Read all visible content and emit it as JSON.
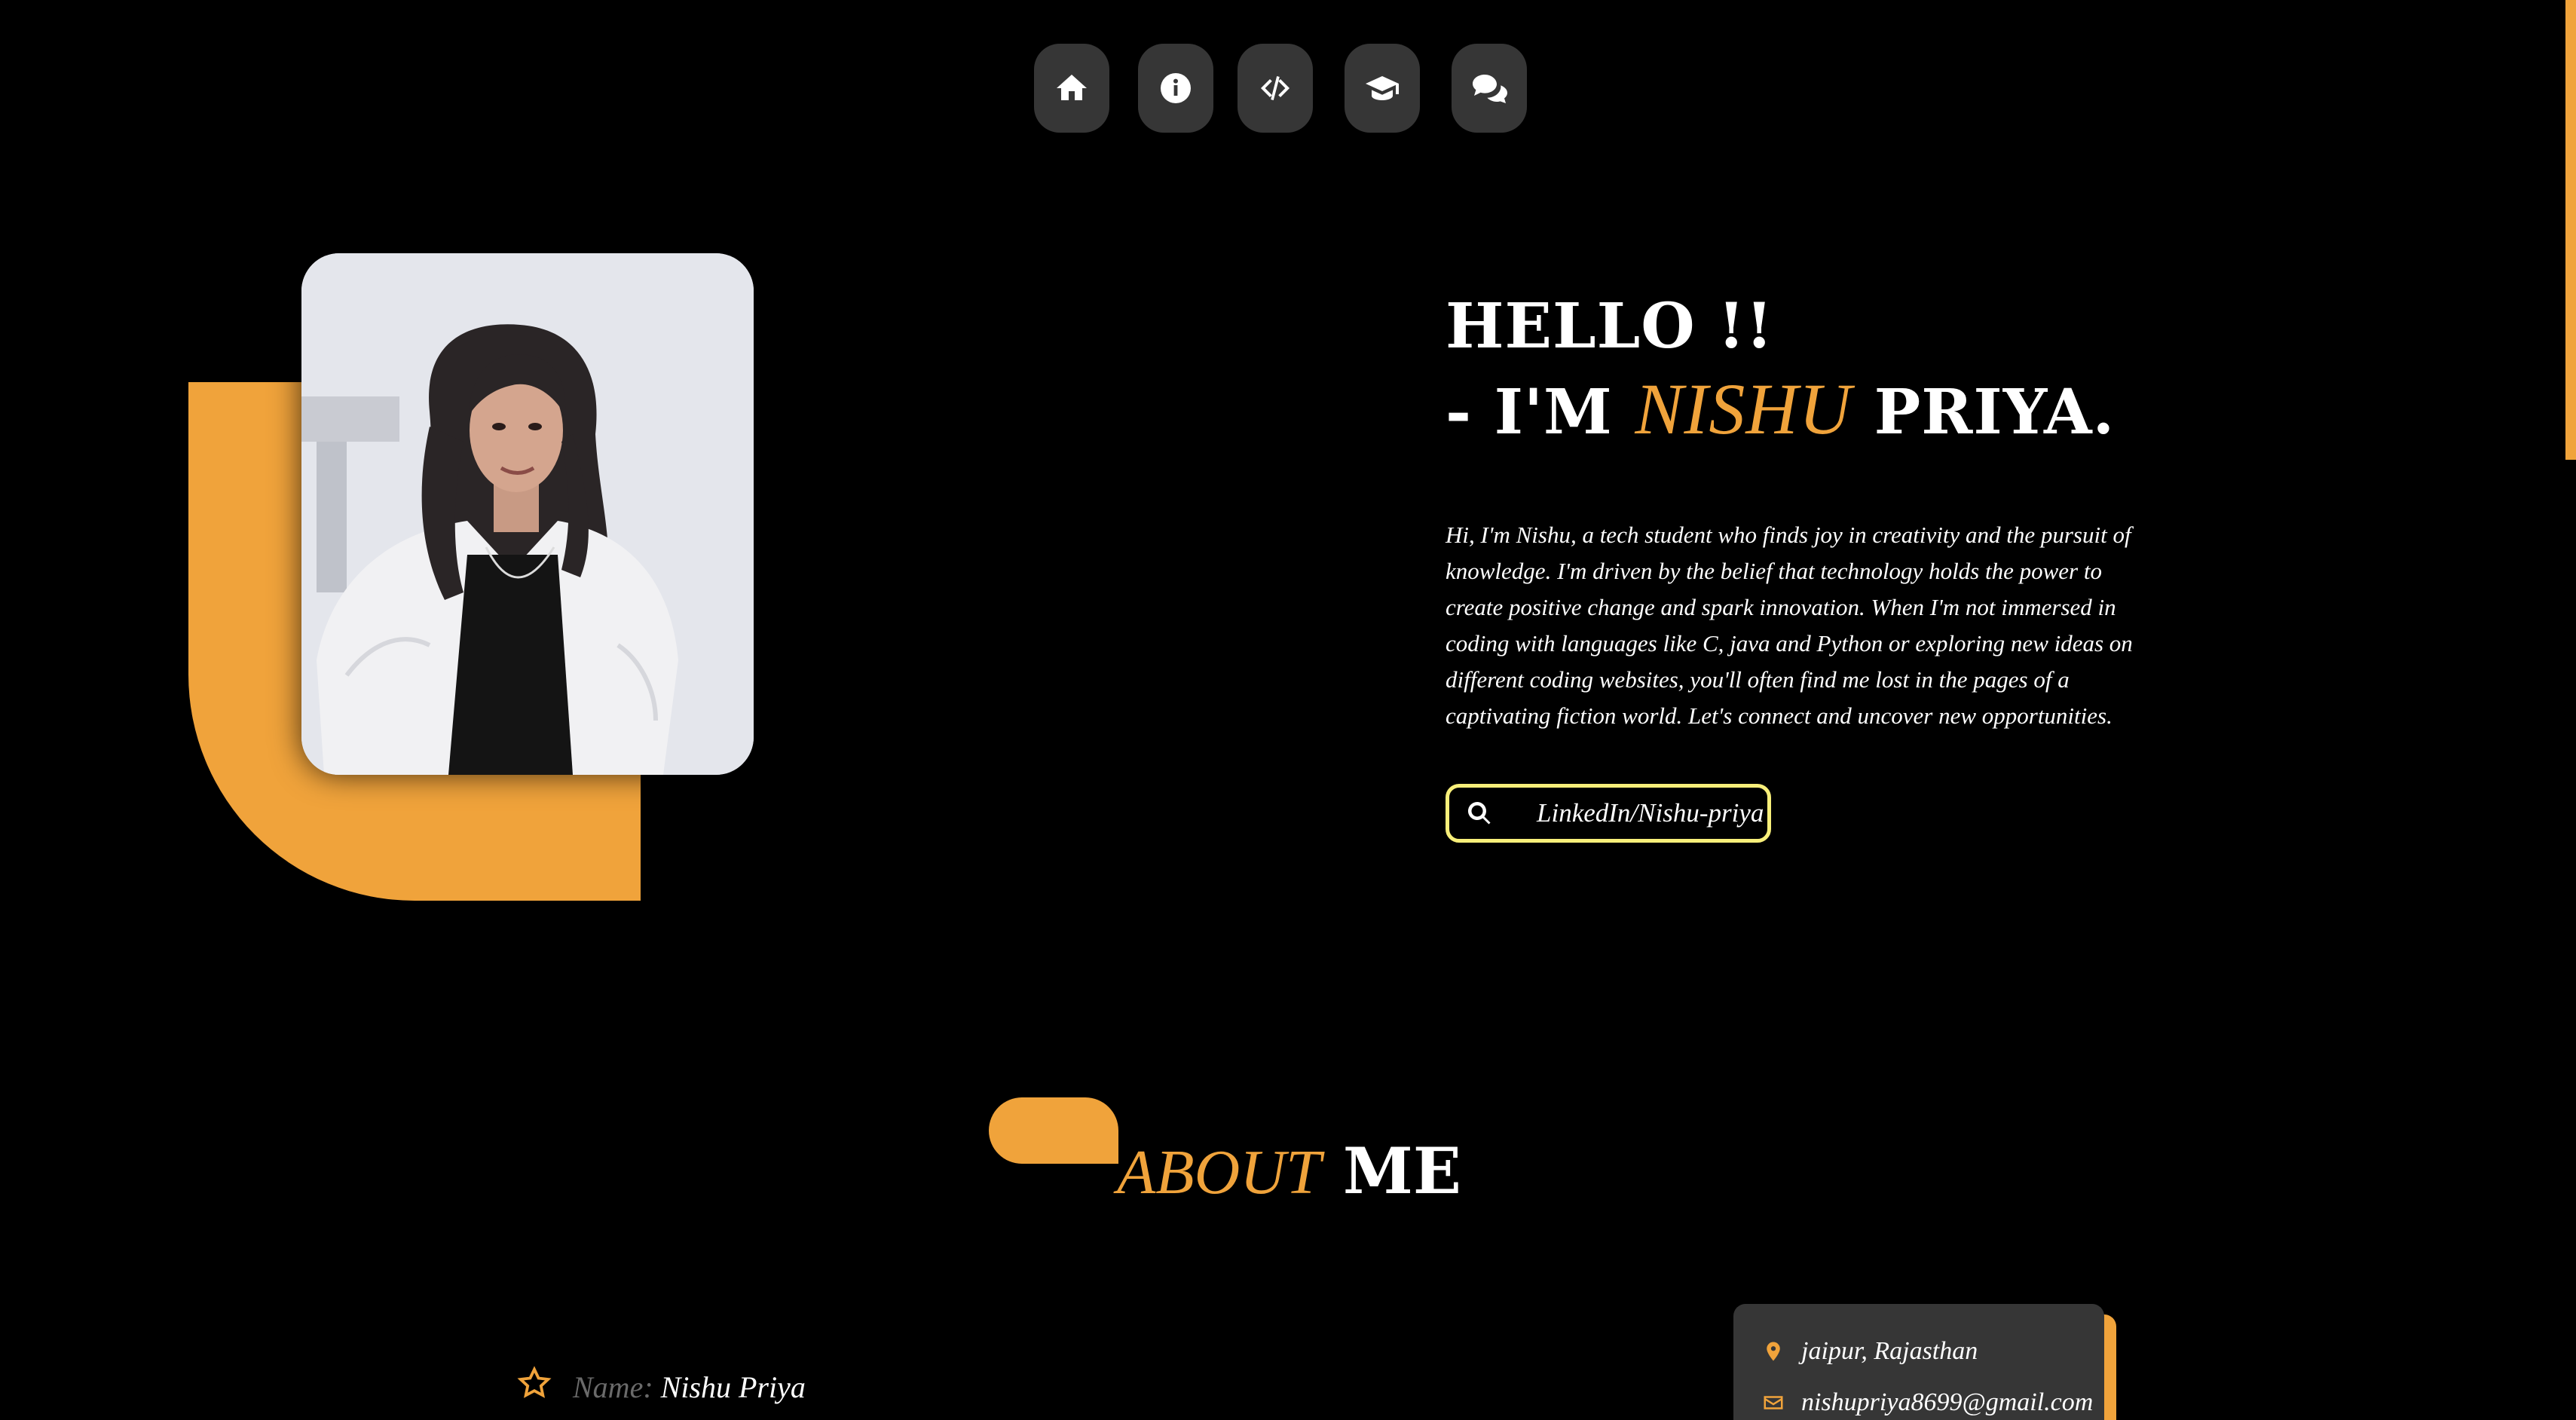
{
  "nav": {
    "items": [
      {
        "icon": "home-icon"
      },
      {
        "icon": "info-icon"
      },
      {
        "icon": "code-icon"
      },
      {
        "icon": "graduation-cap-icon"
      },
      {
        "icon": "chat-icon"
      }
    ]
  },
  "hero": {
    "greeting": "HELLO !!",
    "intro_prefix": "- I'M ",
    "first_name": "NISHU",
    "last_name": " PRIYA.",
    "bio": "Hi, I'm Nishu, a tech student who finds joy in creativity and the pursuit of knowledge. I'm driven by the belief that technology holds the power to create positive change and spark innovation. When I'm not immersed in coding with languages like C, java and Python or exploring new ideas on different coding websites, you'll often find me lost in the pages of a captivating fiction world. Let's connect and uncover new opportunities.",
    "link_label": "LinkedIn/Nishu-priya"
  },
  "about": {
    "title_accent": "ABOUT",
    "title_rest": " ME",
    "name_key": "Name:",
    "name_value": "Nishu Priya",
    "location": "jaipur, Rajasthan",
    "email": "nishupriya8699@gmail.com"
  },
  "colors": {
    "accent": "#f0a33b",
    "nav_bg": "#363636",
    "link_border": "#f8ef7a",
    "background": "#000000"
  }
}
